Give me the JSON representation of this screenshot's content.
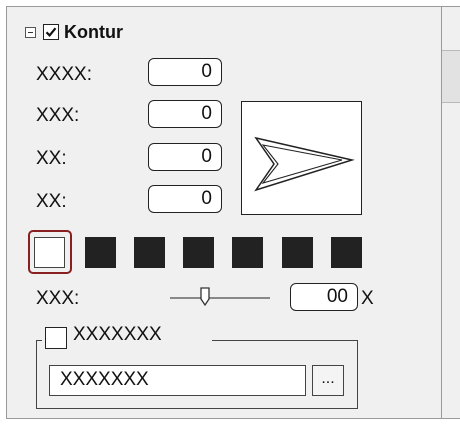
{
  "section": {
    "title": "Kontur",
    "enabled": true,
    "expanded": true
  },
  "fields": [
    {
      "label": "XXXX:",
      "value": "0"
    },
    {
      "label": "XXX:",
      "value": "0"
    },
    {
      "label": "XX:",
      "value": "0"
    },
    {
      "label": "XX:",
      "value": "0"
    }
  ],
  "swatches": {
    "selected_index": 0,
    "colors": [
      "#ffffff",
      "#222222",
      "#222222",
      "#222222",
      "#222222",
      "#222222",
      "#222222"
    ]
  },
  "slider": {
    "label": "XXX:",
    "value": "00",
    "unit": "X"
  },
  "group": {
    "checkbox_label": "XXXXXXX",
    "checked": false,
    "field_value": "XXXXXXX",
    "browse_label": "..."
  },
  "icons": {
    "preview": "arrowhead-outline-icon"
  }
}
